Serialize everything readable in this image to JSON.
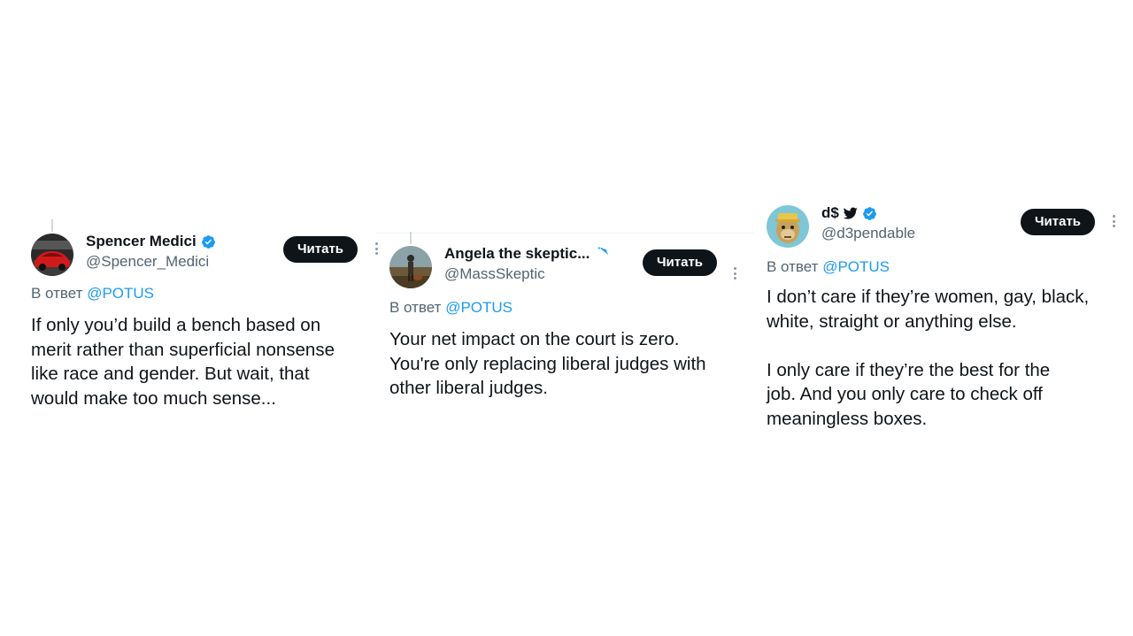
{
  "tweets": [
    {
      "display_name": "Spencer Medici",
      "handle": "@Spencer_Medici",
      "follow_label": "Читать",
      "reply_prefix": "В ответ",
      "reply_mention": "@POTUS",
      "text": "If only you’d build a bench based on\nmerit rather than superficial nonsense\nlike race  and gender. But wait, that\nwould make too much sense...",
      "avatar_icon": "red-car-avatar"
    },
    {
      "display_name": "Angela the skeptic...",
      "handle": "@MassSkeptic",
      "follow_label": "Читать",
      "reply_prefix": "В ответ",
      "reply_mention": "@POTUS",
      "text": "Your net impact on the court is zero.\nYou're only replacing liberal judges with\nother liberal judges.",
      "avatar_icon": "person-with-dog-avatar"
    },
    {
      "display_name": "d$",
      "handle": "@d3pendable",
      "follow_label": "Читать",
      "reply_prefix": "В ответ",
      "reply_mention": "@POTUS",
      "text": "I don’t care if they’re women, gay, black,\nwhite, straight or anything else.\n\nI only care if they’re the best for the\njob. And you only care to check off\nmeaningless boxes.",
      "avatar_icon": "cartoon-ape-avatar"
    }
  ],
  "colors": {
    "text": "#0f1419",
    "secondary": "#536471",
    "link": "#1d9bf0",
    "verified": "#1d9bf0",
    "button_bg": "#0f1419"
  }
}
